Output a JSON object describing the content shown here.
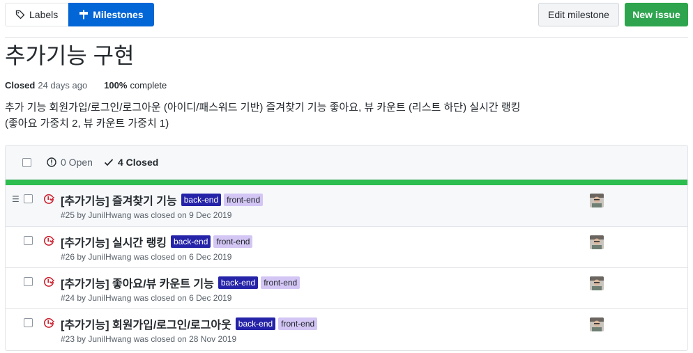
{
  "subnav": {
    "labels": "Labels",
    "milestones": "Milestones"
  },
  "actions": {
    "edit_milestone": "Edit milestone",
    "new_issue": "New issue"
  },
  "milestone": {
    "title": "추가기능 구현",
    "status": "Closed",
    "closed_ago": "24 days ago",
    "percent": "100%",
    "complete_label": "complete",
    "description": "추가 기능 회원가입/로그인/로그아운 (아이디/패스워드 기반) 즐겨찾기 기능 좋아요, 뷰 카운트 (리스트 하단) 실시간 랭킹 (좋아요 가중치 2, 뷰 카운트 가중치 1)"
  },
  "filters": {
    "open": "0 Open",
    "closed": "4 Closed"
  },
  "progress_fraction": 1.0,
  "colors": {
    "primary": "#0366d6",
    "success": "#2ea44f",
    "progress": "#2cbe4e",
    "closed_icon": "#cb2431",
    "label_backend": "#2523a8",
    "label_frontend": "#d3c6f4"
  },
  "issues": [
    {
      "title": "[추가기능] 즐겨찾기 기능",
      "labels": [
        "back-end",
        "front-end"
      ],
      "meta": "#25 by JunilHwang was closed on 9 Dec 2019"
    },
    {
      "title": "[추가기능] 실시간 랭킹",
      "labels": [
        "back-end",
        "front-end"
      ],
      "meta": "#26 by JunilHwang was closed on 6 Dec 2019"
    },
    {
      "title": "[추가기능] 좋아요/뷰 카운트 기능",
      "labels": [
        "back-end",
        "front-end"
      ],
      "meta": "#24 by JunilHwang was closed on 6 Dec 2019"
    },
    {
      "title": "[추가기능] 회원가입/로그인/로그아웃",
      "labels": [
        "back-end",
        "front-end"
      ],
      "meta": "#23 by JunilHwang was closed on 28 Nov 2019"
    }
  ]
}
